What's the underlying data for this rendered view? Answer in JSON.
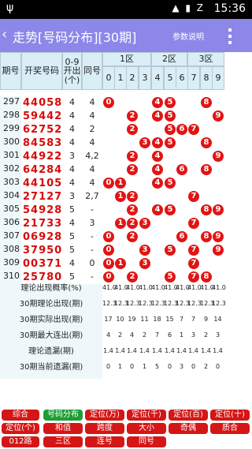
{
  "status": {
    "time": "15:36",
    "usb": "ψ",
    "signal": "▲ ▮ Z"
  },
  "header": {
    "back": "‹",
    "title": "走势[号码分布][30期]",
    "help": "参数说明"
  },
  "table": {
    "headers": {
      "issue": "期号",
      "num": "开奖号码",
      "zero9": "0-9\n开出\n(个)",
      "same": "同号",
      "zone1": "1区",
      "zone2": "2区",
      "zone3": "3区",
      "digits": [
        "0",
        "1",
        "2",
        "3",
        "4",
        "5",
        "6",
        "7",
        "8",
        "9"
      ]
    },
    "rows": [
      {
        "issue": "297",
        "num": "44058",
        "zero9": "4",
        "same": "4"
      },
      {
        "issue": "298",
        "num": "59442",
        "zero9": "4",
        "same": "4"
      },
      {
        "issue": "299",
        "num": "62752",
        "zero9": "4",
        "same": "2"
      },
      {
        "issue": "300",
        "num": "84583",
        "zero9": "4",
        "same": "4"
      },
      {
        "issue": "301",
        "num": "44922",
        "zero9": "3",
        "same": "4,2"
      },
      {
        "issue": "302",
        "num": "64284",
        "zero9": "4",
        "same": "4"
      },
      {
        "issue": "303",
        "num": "44105",
        "zero9": "4",
        "same": "4"
      },
      {
        "issue": "304",
        "num": "27127",
        "zero9": "3",
        "same": "2,7"
      },
      {
        "issue": "305",
        "num": "54928",
        "zero9": "5",
        "same": "-"
      },
      {
        "issue": "306",
        "num": "21733",
        "zero9": "4",
        "same": "3"
      },
      {
        "issue": "307",
        "num": "06928",
        "zero9": "5",
        "same": "-"
      },
      {
        "issue": "308",
        "num": "37950",
        "zero9": "5",
        "same": "-"
      },
      {
        "issue": "309",
        "num": "00371",
        "zero9": "4",
        "same": "0"
      },
      {
        "issue": "310",
        "num": "25780",
        "zero9": "5",
        "same": "-"
      }
    ],
    "stats": [
      {
        "label": "理论出现概率(%)",
        "values": [
          "41.0",
          "41.0",
          "41.0",
          "41.0",
          "41.0",
          "41.0",
          "41.0",
          "41.0",
          "41.0",
          "41.0"
        ]
      },
      {
        "label": "30期理论出现(期)",
        "values": [
          "12.3",
          "12.3",
          "12.3",
          "12.3",
          "12.3",
          "12.3",
          "12.3",
          "12.3",
          "12.3",
          "12.3"
        ]
      },
      {
        "label": "30期实际出现(期)",
        "values": [
          "17",
          "10",
          "19",
          "11",
          "18",
          "15",
          "7",
          "7",
          "9",
          "14"
        ]
      },
      {
        "label": "30期最大连出(期)",
        "values": [
          "4",
          "2",
          "4",
          "2",
          "7",
          "6",
          "1",
          "3",
          "2",
          "3"
        ]
      },
      {
        "label": "理论遗漏(期)",
        "values": [
          "1.4",
          "1.4",
          "1.4",
          "1.4",
          "1.4",
          "1.4",
          "1.4",
          "1.4",
          "1.4",
          "1.4"
        ]
      },
      {
        "label": "30期当前遗漏(期)",
        "values": [
          "0",
          "1",
          "0",
          "1",
          "5",
          "0",
          "3",
          "0",
          "2",
          "0"
        ]
      }
    ]
  },
  "buttons": [
    {
      "label": "综合",
      "active": false
    },
    {
      "label": "号码分布",
      "active": true
    },
    {
      "label": "定位(万)",
      "active": false
    },
    {
      "label": "定位(千)",
      "active": false
    },
    {
      "label": "定位(百)",
      "active": false
    },
    {
      "label": "定位(十)",
      "active": false
    },
    {
      "label": "定位(个)",
      "active": false
    },
    {
      "label": "和值",
      "active": false
    },
    {
      "label": "跨度",
      "active": false
    },
    {
      "label": "大小",
      "active": false
    },
    {
      "label": "奇偶",
      "active": false
    },
    {
      "label": "质合",
      "active": false
    },
    {
      "label": "012路",
      "active": false
    },
    {
      "label": "三区",
      "active": false
    },
    {
      "label": "连号",
      "active": false
    },
    {
      "label": "同号",
      "active": false
    }
  ],
  "colors": {
    "title_bg": "#8c87e9",
    "active_btn": "#1f9d35",
    "btn": "#d51616",
    "ball": "#e21414"
  }
}
